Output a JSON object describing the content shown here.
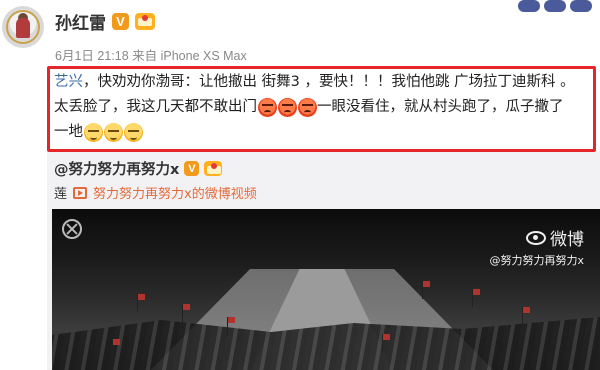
{
  "post": {
    "username": "孙红雷",
    "verified_badge": "V",
    "meta": "6月1日 21:18 来自 iPhone XS Max",
    "lines": [
      [
        "艺兴",
        "，快劝劝你渤哥：让他撤出 街舞3 ，要快！！！我怕他跳 广场拉丁迪斯科 。"
      ],
      [
        "太丢脸了，我这几天都不敢出门",
        "一眼没看住，就从村头跑了，瓜子撒了"
      ],
      [
        "一地"
      ]
    ]
  },
  "repost": {
    "author": "@努力努力再努力x",
    "verified_badge": "V",
    "lead": "莲",
    "video_link": "努力努力再努力x的微博视频"
  },
  "video": {
    "watermark_title": "微博",
    "watermark_user": "@努力努力再努力x"
  },
  "colors": {
    "highlight_border": "#e4262a",
    "link": "#3b6aa7",
    "video_link": "#e26a3a",
    "verified": "#f29a1b"
  }
}
